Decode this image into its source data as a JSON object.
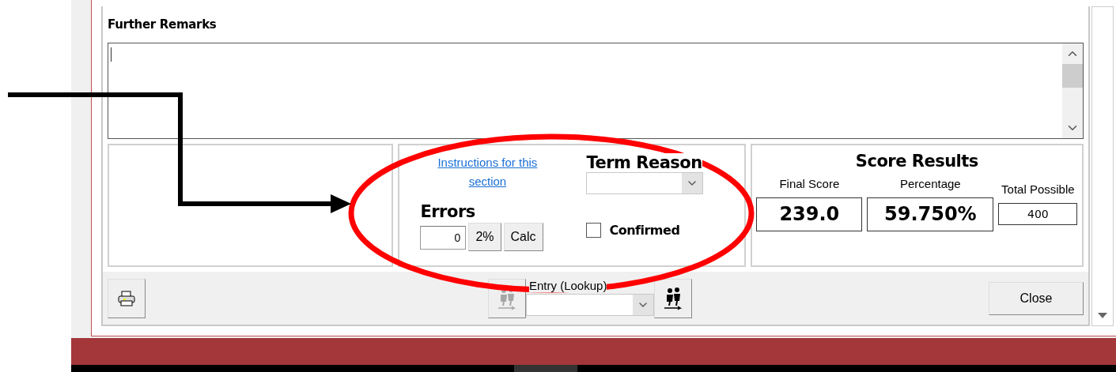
{
  "remarks": {
    "label": "Further Remarks"
  },
  "instructions_link": "Instructions for this section",
  "errors": {
    "label": "Errors",
    "value": "0",
    "buttons": [
      "2%",
      "Calc"
    ]
  },
  "term_reason": {
    "label": "Term Reason"
  },
  "confirmed": {
    "label": "Confirmed",
    "checked": false
  },
  "score_results": {
    "title": "Score Results",
    "fields": [
      {
        "label": "Final Score",
        "value": "239.0",
        "kind": "large"
      },
      {
        "label": "Percentage",
        "value": "59.750%",
        "kind": "large"
      },
      {
        "label": "Total Possible",
        "value": "400",
        "kind": "small"
      }
    ]
  },
  "footer": {
    "entry_label": "Entry (Lookup)",
    "previous_disabled": true,
    "close": "Close"
  }
}
